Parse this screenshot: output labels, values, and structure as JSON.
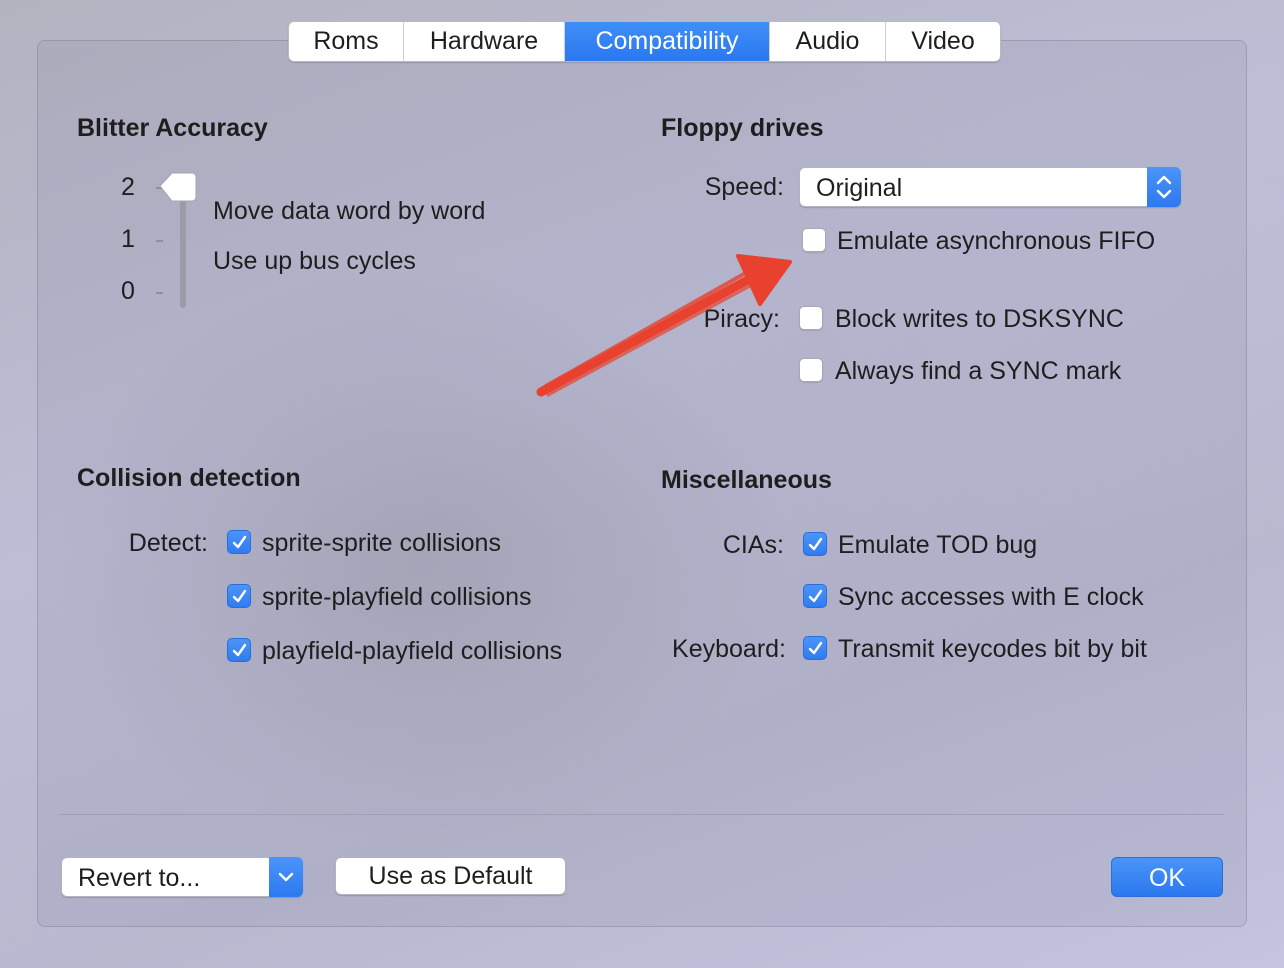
{
  "tabs": [
    {
      "label": "Roms",
      "active": false
    },
    {
      "label": "Hardware",
      "active": false
    },
    {
      "label": "Compatibility",
      "active": true
    },
    {
      "label": "Audio",
      "active": false
    },
    {
      "label": "Video",
      "active": false
    }
  ],
  "blitter": {
    "heading": "Blitter Accuracy",
    "levels": [
      "2",
      "1",
      "0"
    ],
    "selected_level": 2,
    "desc1": "Move data word by word",
    "desc2": "Use up bus cycles"
  },
  "floppy": {
    "heading": "Floppy drives",
    "speed_label": "Speed:",
    "speed_value": "Original",
    "async_fifo": {
      "label": "Emulate asynchronous FIFO",
      "checked": false
    },
    "piracy_label": "Piracy:",
    "block_writes": {
      "label": "Block writes to DSKSYNC",
      "checked": false
    },
    "sync_mark": {
      "label": "Always find a SYNC mark",
      "checked": false
    }
  },
  "collision": {
    "heading": "Collision detection",
    "detect_label": "Detect:",
    "items": [
      {
        "label": "sprite-sprite collisions",
        "checked": true
      },
      {
        "label": "sprite-playfield collisions",
        "checked": true
      },
      {
        "label": "playfield-playfield collisions",
        "checked": true
      }
    ]
  },
  "misc": {
    "heading": "Miscellaneous",
    "cias_label": "CIAs:",
    "tod_bug": {
      "label": "Emulate TOD bug",
      "checked": true
    },
    "e_clock": {
      "label": "Sync accesses with E clock",
      "checked": true
    },
    "keyboard_label": "Keyboard:",
    "keycodes": {
      "label": "Transmit keycodes bit by bit",
      "checked": true
    }
  },
  "footer": {
    "revert_label": "Revert to...",
    "default_label": "Use as Default",
    "ok_label": "OK"
  },
  "colors": {
    "accent": "#2f7cf2",
    "annotation_arrow": "#e8412e"
  }
}
